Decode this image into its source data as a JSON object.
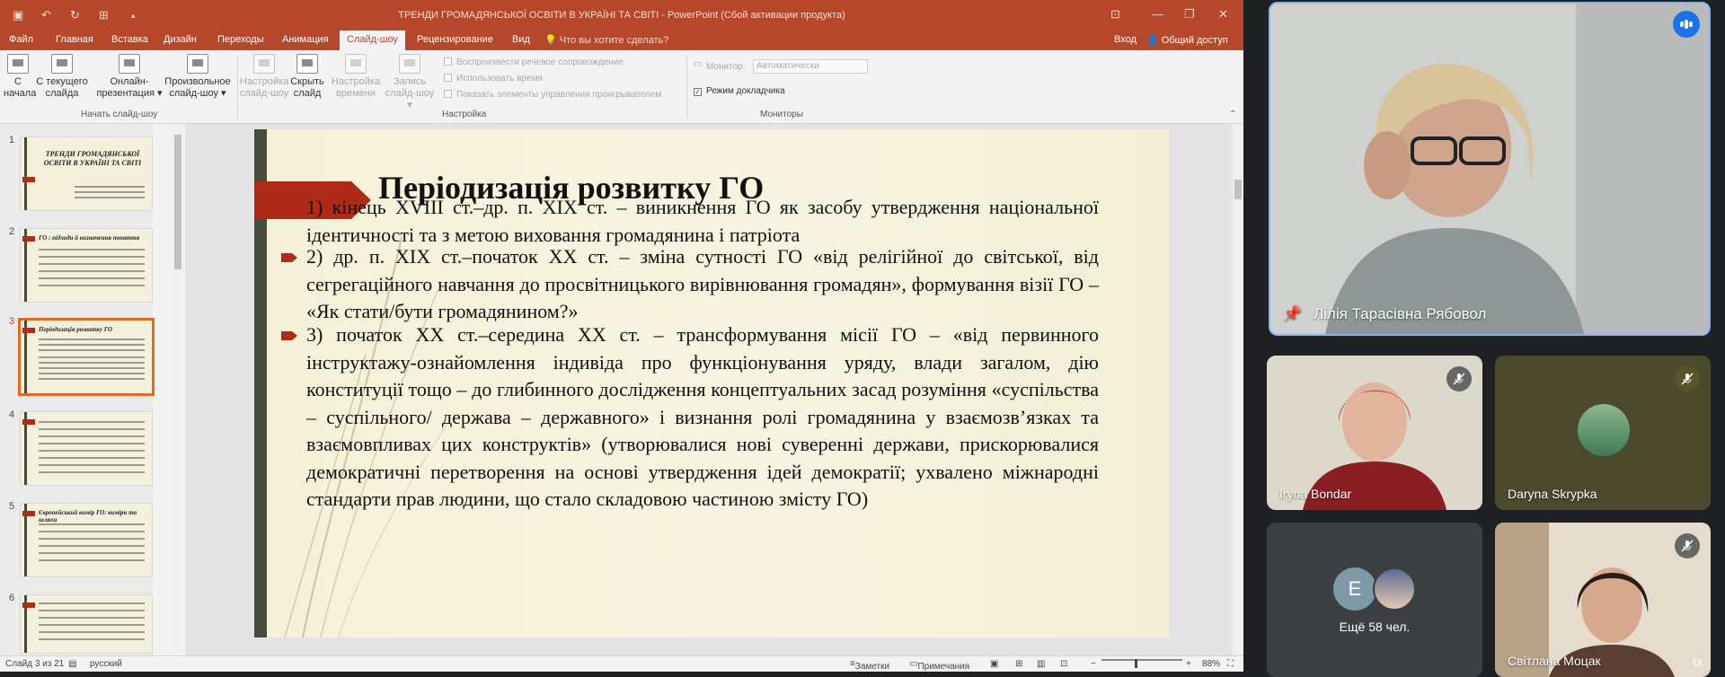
{
  "window": {
    "title": "ТРЕНДИ ГРОМАДЯНСЬКОЇ ОСВІТИ В УКРАЇНІ ТА СВІТІ - PowerPoint (Сбой активации продукта)",
    "tabs": [
      "Файл",
      "Главная",
      "Вставка",
      "Дизайн",
      "Переходы",
      "Анимация",
      "Слайд-шоу",
      "Рецензирование",
      "Вид"
    ],
    "tell_me": "Что вы хотите сделать?",
    "login": "Вход",
    "share": "Общий доступ"
  },
  "ribbon": {
    "start_group_label": "Начать слайд-шоу",
    "setup_group_label": "Настройка",
    "monitors_group_label": "Мониторы",
    "buttons": {
      "from_start": [
        "С",
        "начала"
      ],
      "from_current": [
        "С текущего",
        "слайда"
      ],
      "online": [
        "Онлайн-",
        "презентация ▾"
      ],
      "custom": [
        "Произвольное",
        "слайд-шоу ▾"
      ],
      "setup": [
        "Настройка",
        "слайд-шоу"
      ],
      "hide": [
        "Скрыть",
        "слайд"
      ],
      "rehearse": [
        "Настройка",
        "времени"
      ],
      "record": [
        "Запись",
        "слайд-шоу ▾"
      ]
    },
    "checkboxes": [
      "Воспроизвести речевое сопровождение",
      "Использовать время",
      "Показать элементы управления проигрывателем"
    ],
    "monitor_label": "Монитор:",
    "monitor_value": "Автоматически",
    "presenter_view": "Режим докладчика"
  },
  "thumbnails": [
    {
      "num": "1",
      "title": "ТРЕНДИ ГРОМАДЯНСЬКОЇ ОСВІТИ В УКРАЇНІ ТА СВІТІ"
    },
    {
      "num": "2",
      "title": "ГО : підходи й визначення поняття"
    },
    {
      "num": "3",
      "title": "Періодизація розвитку ГО"
    },
    {
      "num": "4",
      "title": ""
    },
    {
      "num": "5",
      "title": "Європейський вимір ГО: виміри та шляхи"
    },
    {
      "num": "6",
      "title": ""
    }
  ],
  "slide": {
    "title": "Періодизація розвитку ГО",
    "bullets": [
      "1) кінець XVIII ст.–др. п. XIX ст. – виникнення ГО як засобу утвердження національної ідентичності та з метою виховання громадянина і патріота",
      "2) др. п. XIX ст.–початок XX ст. – зміна сутності ГО «від релігійної до світської, від сегрегаційного навчання до просвітницького вирівнювання громадян», формування візії ГО – «Як стати/бути громадянином?»",
      "3) початок XX ст.–середина XX ст. – трансформування місії ГО – «від первинного інструктажу-ознайомлення індивіда про функціонування уряду, влади загалом, дію конституції тощо – до глибинного дослідження концептуальних засад розуміння «суспільства – суспільного/ держава – державного» і визнання ролі громадянина у взаємозв’язках та взаємовпливах цих конструктів» (утворювалися нові суверенні держави, прискорювалися демократичні перетворення на основі утвердження ідей демократії; ухвалено міжнародні стандарти прав людини, що стало складовою частиною змісту ГО)"
    ]
  },
  "status": {
    "slide_counter": "Слайд 3 из 21",
    "language": "русский",
    "notes": "Заметки",
    "comments": "Примечания",
    "zoom": "88%"
  },
  "meet": {
    "main_speaker": "Лілія Тарасівна Рябовол",
    "participants": [
      {
        "name": "Iryna Bondar"
      },
      {
        "name": "Daryna Skrypka"
      },
      {
        "name": "Ещё 58 чел.",
        "initial": "E"
      },
      {
        "name": "Світлана Моцак"
      }
    ]
  },
  "colors": {
    "ppt_accent": "#b7472a",
    "meet_active_border": "#8ab4f8",
    "slide_accent": "#b02a18"
  }
}
